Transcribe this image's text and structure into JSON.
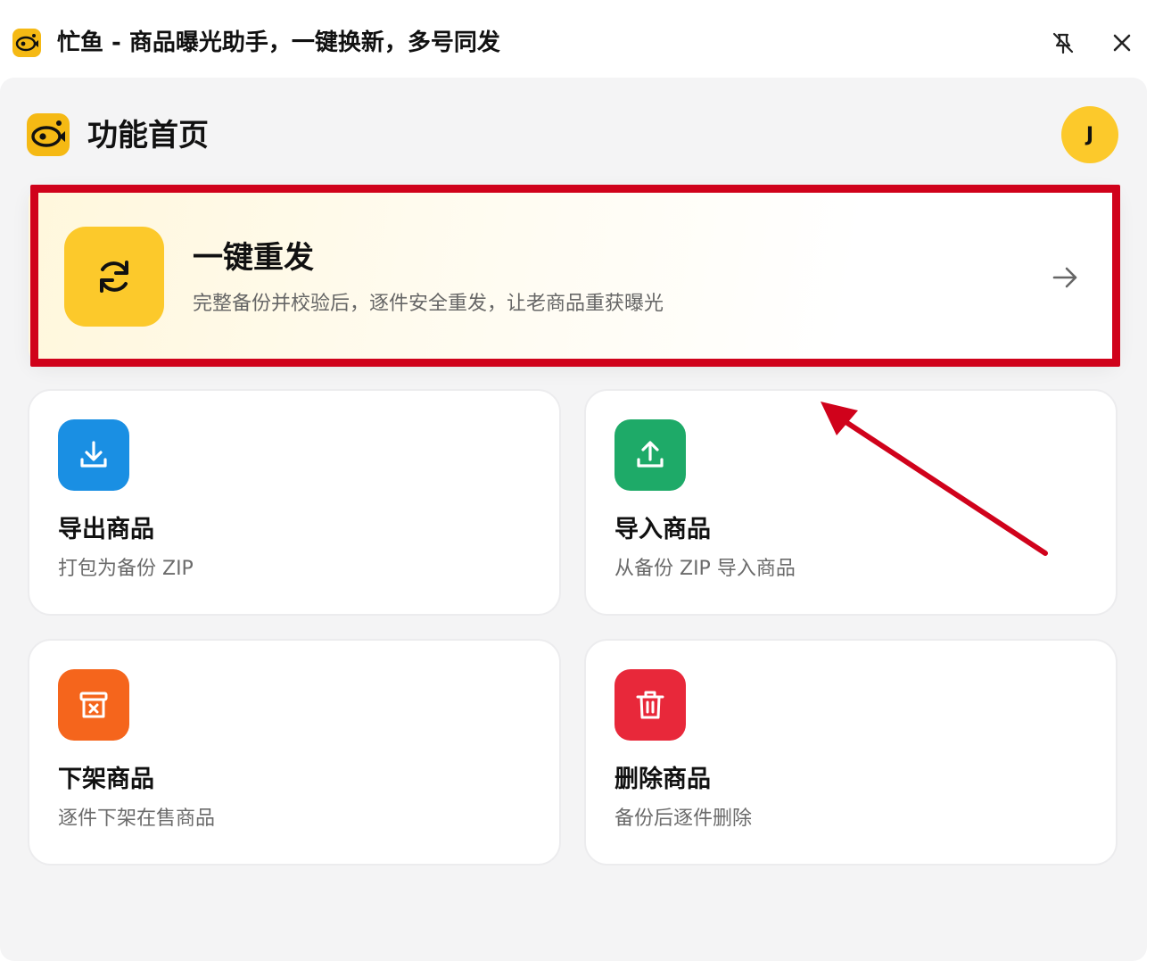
{
  "window": {
    "title": "忙鱼 - 商品曝光助手，一键换新，多号同发",
    "pin_icon": "pin-off-icon",
    "close_icon": "close-icon"
  },
  "header": {
    "title": "功能首页",
    "avatar_initial": "J"
  },
  "hero": {
    "title": "一键重发",
    "subtitle": "完整备份并校验后，逐件安全重发，让老商品重获曝光",
    "icon": "refresh-icon",
    "arrow_icon": "arrow-right-icon"
  },
  "cards": [
    {
      "title": "导出商品",
      "subtitle": "打包为备份 ZIP",
      "icon": "download-icon",
      "color": "#1a8fe3"
    },
    {
      "title": "导入商品",
      "subtitle": "从备份 ZIP 导入商品",
      "icon": "upload-icon",
      "color": "#1eaa68"
    },
    {
      "title": "下架商品",
      "subtitle": "逐件下架在售商品",
      "icon": "archive-x-icon",
      "color": "#f5651c"
    },
    {
      "title": "删除商品",
      "subtitle": "备份后逐件删除",
      "icon": "trash-icon",
      "color": "#e8283a"
    }
  ],
  "colors": {
    "brand": "#f5b914",
    "highlight": "#d0021b"
  }
}
